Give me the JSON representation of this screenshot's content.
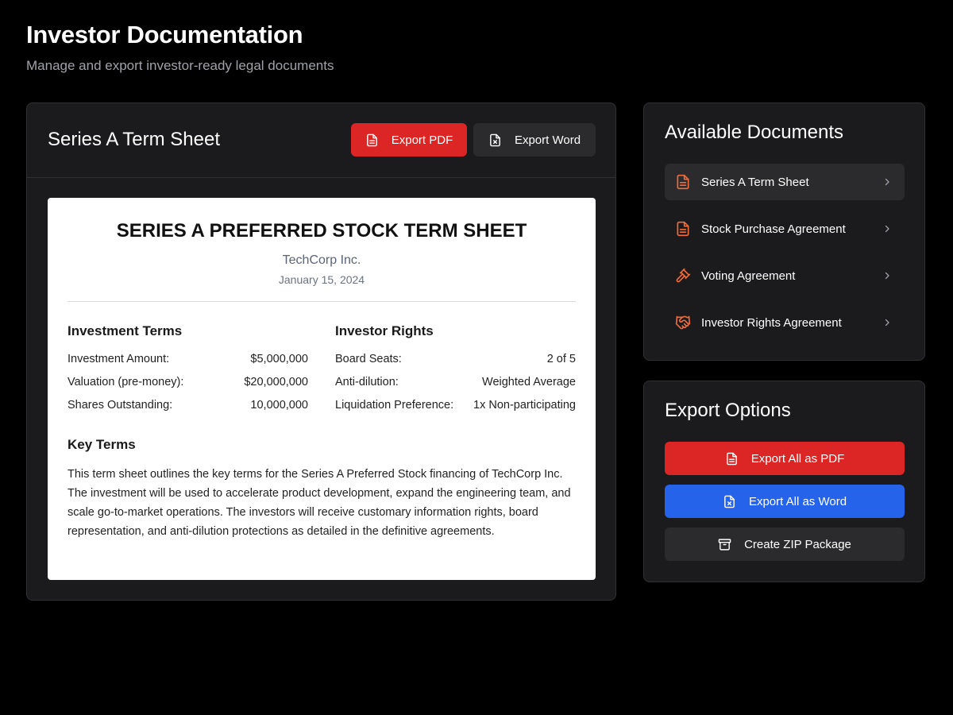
{
  "header": {
    "title": "Investor Documentation",
    "subtitle": "Manage and export investor-ready legal documents"
  },
  "document_panel": {
    "title": "Series A Term Sheet",
    "export_pdf_label": "Export PDF",
    "export_word_label": "Export Word",
    "paper": {
      "heading": "SERIES A PREFERRED STOCK TERM SHEET",
      "company": "TechCorp Inc.",
      "date": "January 15, 2024",
      "investment_terms": {
        "title": "Investment Terms",
        "rows": [
          {
            "label": "Investment Amount:",
            "value": "$5,000,000"
          },
          {
            "label": "Valuation (pre-money):",
            "value": "$20,000,000"
          },
          {
            "label": "Shares Outstanding:",
            "value": "10,000,000"
          }
        ]
      },
      "investor_rights": {
        "title": "Investor Rights",
        "rows": [
          {
            "label": "Board Seats:",
            "value": "2 of 5"
          },
          {
            "label": "Anti-dilution:",
            "value": "Weighted Average"
          },
          {
            "label": "Liquidation Preference:",
            "value": "1x Non-participating"
          }
        ]
      },
      "key_terms": {
        "title": "Key Terms",
        "body": "This term sheet outlines the key terms for the Series A Preferred Stock financing of TechCorp Inc. The investment will be used to accelerate product development, expand the engineering team, and scale go-to-market operations. The investors will receive customary information rights, board representation, and anti-dilution protections as detailed in the definitive agreements."
      }
    }
  },
  "available_documents": {
    "title": "Available Documents",
    "items": [
      {
        "label": "Series A Term Sheet",
        "icon": "document-icon",
        "active": true
      },
      {
        "label": "Stock Purchase Agreement",
        "icon": "document-icon",
        "active": false
      },
      {
        "label": "Voting Agreement",
        "icon": "gavel-icon",
        "active": false
      },
      {
        "label": "Investor Rights Agreement",
        "icon": "handshake-icon",
        "active": false
      }
    ]
  },
  "export_options": {
    "title": "Export Options",
    "export_all_pdf_label": "Export All as PDF",
    "export_all_word_label": "Export All as Word",
    "create_zip_label": "Create ZIP Package"
  },
  "colors": {
    "background": "#000000",
    "card": "#1b1b1d",
    "card_border": "#313134",
    "accent_red": "#dc2626",
    "accent_blue": "#2563eb",
    "icon_orange": "#f26b3a",
    "secondary_button": "#2b2b2e"
  }
}
